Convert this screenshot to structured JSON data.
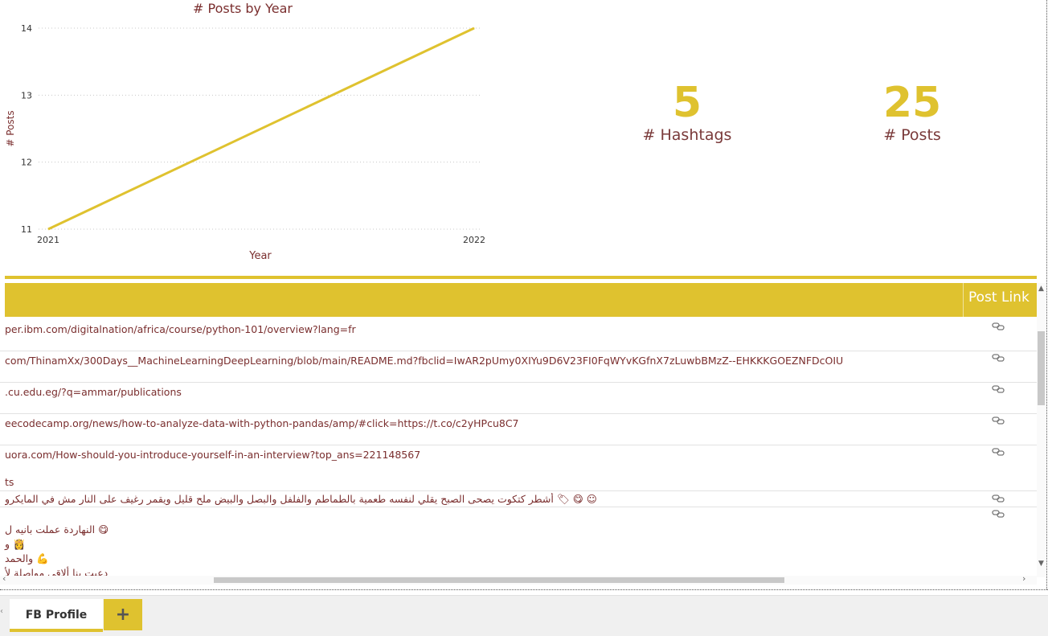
{
  "chart_data": {
    "type": "line",
    "title": "# Posts by Year",
    "xlabel": "Year",
    "ylabel": "# Posts",
    "x": [
      "2021",
      "2022"
    ],
    "series": [
      {
        "values": [
          11,
          14
        ]
      }
    ],
    "yticks": [
      "11",
      "12",
      "13",
      "14"
    ],
    "ylim": [
      11,
      14
    ],
    "grid": true,
    "line_color": "#dfc22f"
  },
  "cards": {
    "hashtags": {
      "value": "5",
      "label": "# Hashtags"
    },
    "posts": {
      "value": "25",
      "label": "# Posts"
    }
  },
  "table": {
    "header": {
      "post_link": "Post Link"
    },
    "rows": [
      {
        "url": "per.ibm.com/digitalnation/africa/course/python-101/overview?lang=fr"
      },
      {
        "url": "com/ThinamXx/300Days__MachineLearningDeepLearning/blob/main/README.md?fbclid=IwAR2pUmy0XIYu9D6V23FI0FqWYvKGfnX7zLuwbBMzZ--EHKKKGOEZNFDcOIU"
      },
      {
        "url": ".cu.edu.eg/?q=ammar/publications"
      },
      {
        "url": "eecodecamp.org/news/how-to-analyze-data-with-python-pandas/amp/#click=https://t.co/c2yHPcu8C7"
      },
      {
        "url": "uora.com/How-should-you-introduce-yourself-in-an-interview?top_ans=221148567",
        "extra": "ts"
      },
      {
        "url": "☺ 😋 🏷 أشطر كتكوت يصحى الصبح يقلي لنفسه طعمية بالطماطم والفلفل والبصل والبيض ملح قليل ويقمر رغيف على النار مش في المايكرو"
      },
      {
        "lines": [
          "😋 النهاردة عملت بانيه ل",
          "👸 و",
          "💪 والحمد",
          "دعبت بنا ألاقي مواصلة لأ"
        ]
      }
    ]
  },
  "tabs": {
    "active": "FB Profile",
    "add": "+"
  }
}
